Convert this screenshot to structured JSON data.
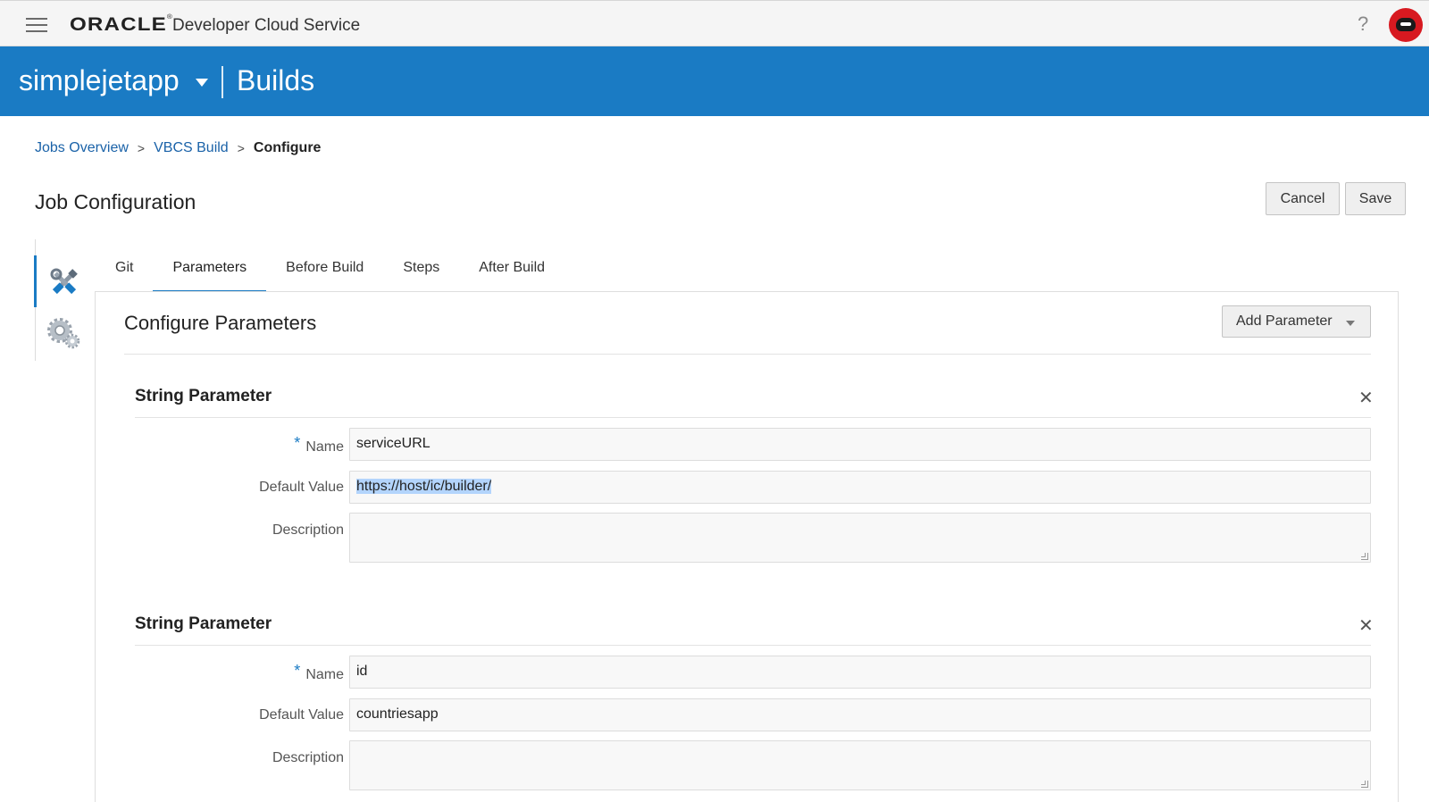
{
  "topbar": {
    "brand_logo": "ORACLE",
    "brand_registered": "®",
    "brand_name": "Developer Cloud Service",
    "help_label": "?"
  },
  "project_bar": {
    "project_name": "simplejetapp",
    "section": "Builds"
  },
  "breadcrumb": {
    "items": [
      "Jobs Overview",
      "VBCS Build"
    ],
    "current": "Configure",
    "separator": ">"
  },
  "page": {
    "title": "Job Configuration",
    "cancel_label": "Cancel",
    "save_label": "Save"
  },
  "tabs": [
    {
      "label": "Git",
      "active": false
    },
    {
      "label": "Parameters",
      "active": true
    },
    {
      "label": "Before Build",
      "active": false
    },
    {
      "label": "Steps",
      "active": false
    },
    {
      "label": "After Build",
      "active": false
    }
  ],
  "side_tabs": [
    {
      "icon": "tools-icon",
      "active": true
    },
    {
      "icon": "gears-icon",
      "active": false
    }
  ],
  "panel": {
    "title": "Configure Parameters",
    "add_button_label": "Add Parameter",
    "close_glyph": "✕",
    "required_marker": "*",
    "parameters": [
      {
        "title": "String Parameter",
        "name_label": "Name",
        "name_value": "serviceURL",
        "default_label": "Default Value",
        "default_value": "https://host/ic/builder/",
        "description_label": "Description",
        "description_value": ""
      },
      {
        "title": "String Parameter",
        "name_label": "Name",
        "name_value": "id",
        "default_label": "Default Value",
        "default_value": "countriesapp",
        "description_label": "Description",
        "description_value": ""
      }
    ]
  },
  "colors": {
    "header_blue": "#1a7bc4",
    "link_blue": "#1a62a8",
    "avatar_red": "#d71920"
  }
}
